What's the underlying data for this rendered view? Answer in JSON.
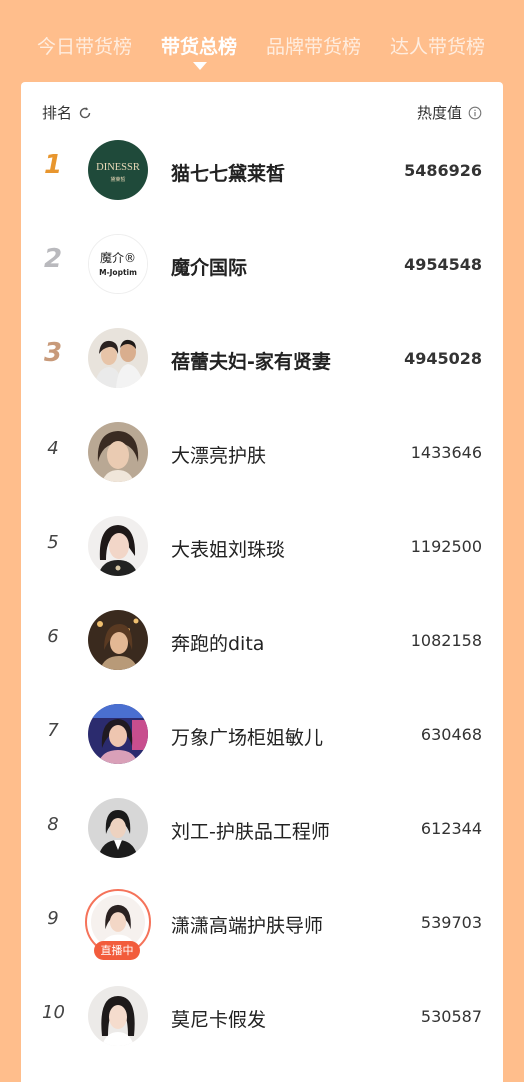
{
  "tabs": [
    {
      "label": "今日带货榜",
      "active": false
    },
    {
      "label": "带货总榜",
      "active": true
    },
    {
      "label": "品牌带货榜",
      "active": false
    },
    {
      "label": "达人带货榜",
      "active": false
    }
  ],
  "header": {
    "rank_label": "排名",
    "heat_label": "热度值",
    "refresh_icon": "refresh-icon",
    "info_icon": "info-icon"
  },
  "colors": {
    "background": "#FFBE8C",
    "rank1": "#E8962E",
    "rank2": "#B9B9BD",
    "rank3": "#C89A7A",
    "live": "#F25C3C"
  },
  "rankings": [
    {
      "rank": "1",
      "name": "猫七七黛莱皙",
      "score": "5486926",
      "logo_text": "DINESSR",
      "logo_sub": "黛莱皙"
    },
    {
      "rank": "2",
      "name": "魔介国际",
      "score": "4954548",
      "logo_text": "魔介®",
      "logo_sub": "M-Joptim"
    },
    {
      "rank": "3",
      "name": "蓓蕾夫妇-家有贤妻",
      "score": "4945028"
    },
    {
      "rank": "4",
      "name": "大漂亮护肤",
      "score": "1433646"
    },
    {
      "rank": "5",
      "name": "大表姐刘珠琰",
      "score": "1192500"
    },
    {
      "rank": "6",
      "name": "奔跑的dita",
      "score": "1082158"
    },
    {
      "rank": "7",
      "name": "万象广场柜姐敏儿",
      "score": "630468"
    },
    {
      "rank": "8",
      "name": "刘工-护肤品工程师",
      "score": "612344"
    },
    {
      "rank": "9",
      "name": "潇潇高端护肤导师",
      "score": "539703",
      "live_label": "直播中"
    },
    {
      "rank": "10",
      "name": "莫尼卡假发",
      "score": "530587"
    }
  ]
}
